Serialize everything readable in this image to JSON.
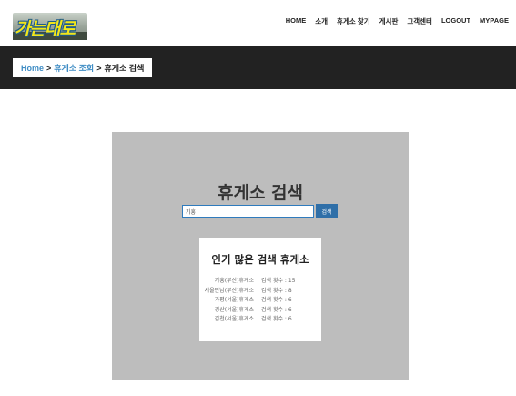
{
  "header": {
    "logo_text": "가는대로",
    "nav": [
      "HOME",
      "소개",
      "휴게소 찾기",
      "게시판",
      "고객센터",
      "LOGOUT",
      "MYPAGE"
    ]
  },
  "breadcrumb": {
    "home": "Home",
    "separator": ">",
    "section": "휴게소 조회",
    "current": "휴게소 검색"
  },
  "search": {
    "title": "휴게소 검색",
    "input_value": "기흥",
    "button_label": "검색"
  },
  "popular": {
    "title": "인기 많은 검색 휴게소",
    "items": [
      {
        "name": "기흥(부산)휴게소",
        "count": "검색 횟수 : 15"
      },
      {
        "name": "서울만남(부산)휴게소",
        "count": "검색 횟수 : 8"
      },
      {
        "name": "가평(서울)휴게소",
        "count": "검색 횟수 : 6"
      },
      {
        "name": "경산(서울)휴게소",
        "count": "검색 횟수 : 6"
      },
      {
        "name": "김천(서울)휴게소",
        "count": "검색 횟수 : 6"
      }
    ]
  },
  "colors": {
    "band": "#222222",
    "panel": "#bdbdbd",
    "accent": "#2f6fa8",
    "link": "#3e8cc4"
  }
}
